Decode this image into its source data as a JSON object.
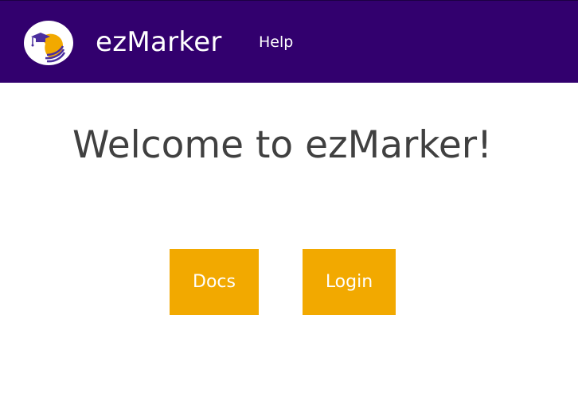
{
  "navbar": {
    "brand": "ezMarker",
    "links": [
      {
        "label": "Help"
      }
    ],
    "logo_icon": "graduation-cap-head-logo"
  },
  "main": {
    "heading": "Welcome to ezMarker!",
    "buttons": {
      "docs": "Docs",
      "login": "Login"
    }
  },
  "colors": {
    "navbar_bg": "#32006e",
    "button_bg": "#f2a900",
    "heading_text": "#404040",
    "logo_accent": "#f2a900",
    "logo_stripes": "#4b2e9e"
  }
}
